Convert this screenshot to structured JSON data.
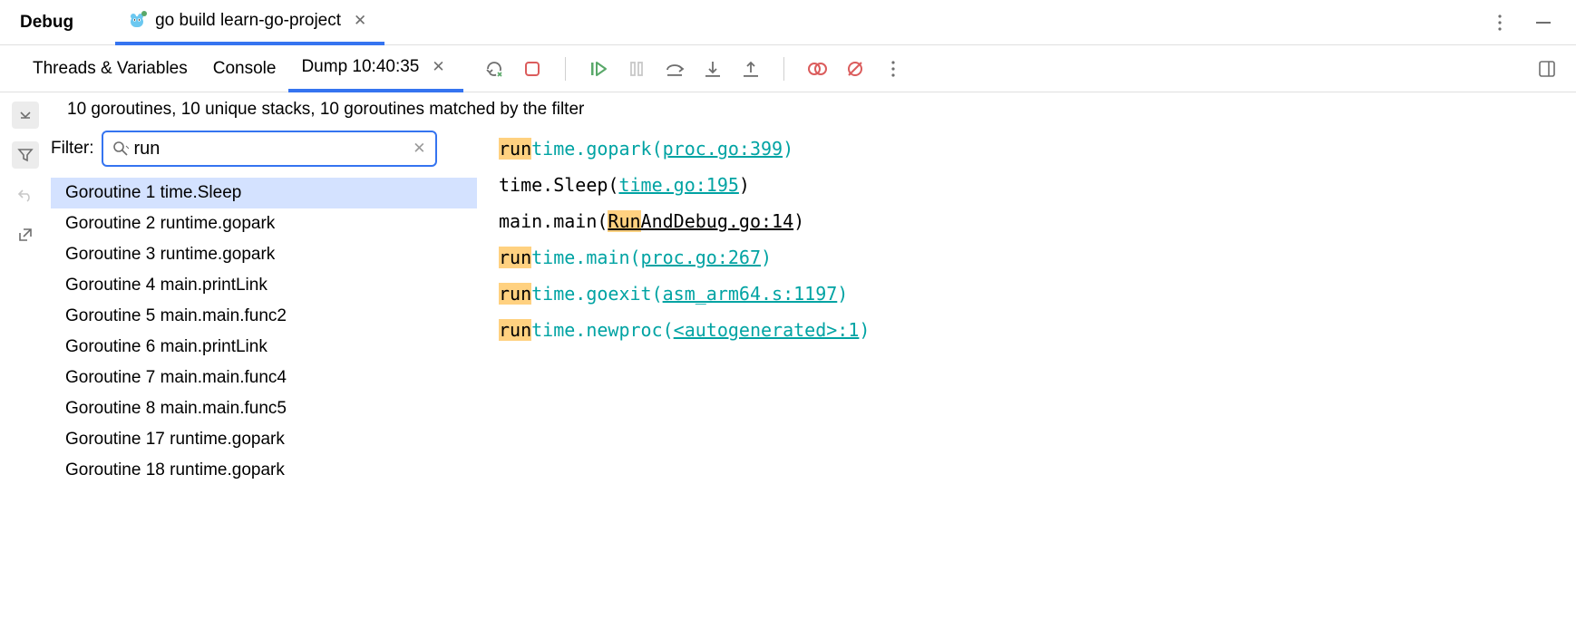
{
  "header": {
    "title": "Debug",
    "run_config": "go build learn-go-project"
  },
  "tabs": {
    "threads": "Threads & Variables",
    "console": "Console",
    "dump": "Dump 10:40:35"
  },
  "summary": "10 goroutines, 10 unique stacks, 10 goroutines matched by the filter",
  "filter": {
    "label": "Filter:",
    "value": "run"
  },
  "goroutines": [
    "Goroutine 1 time.Sleep",
    "Goroutine 2 runtime.gopark",
    "Goroutine 3 runtime.gopark",
    "Goroutine 4 main.printLink",
    "Goroutine 5 main.main.func2",
    "Goroutine 6 main.printLink",
    "Goroutine 7 main.main.func4",
    "Goroutine 8 main.main.func5",
    "Goroutine 17 runtime.gopark",
    "Goroutine 18 runtime.gopark"
  ],
  "stack": [
    {
      "hl": "run",
      "teal": "time.gopark(",
      "link": "proc.go:399",
      "tail": ")"
    },
    {
      "plain_pre": "time.Sleep(",
      "link": "time.go:195",
      "tail": ")"
    },
    {
      "plain_pre": "main.main(",
      "runhl": "Run",
      "runlink": "AndDebug.go:14",
      "tail": ")"
    },
    {
      "hl": "run",
      "teal": "time.main(",
      "link": "proc.go:267",
      "tail": ")"
    },
    {
      "hl": "run",
      "teal": "time.goexit(",
      "link": "asm_arm64.s:1197",
      "tail": ")"
    },
    {
      "hl": "run",
      "teal": "time.newproc(",
      "link": "<autogenerated>:1",
      "tail": ")"
    }
  ]
}
